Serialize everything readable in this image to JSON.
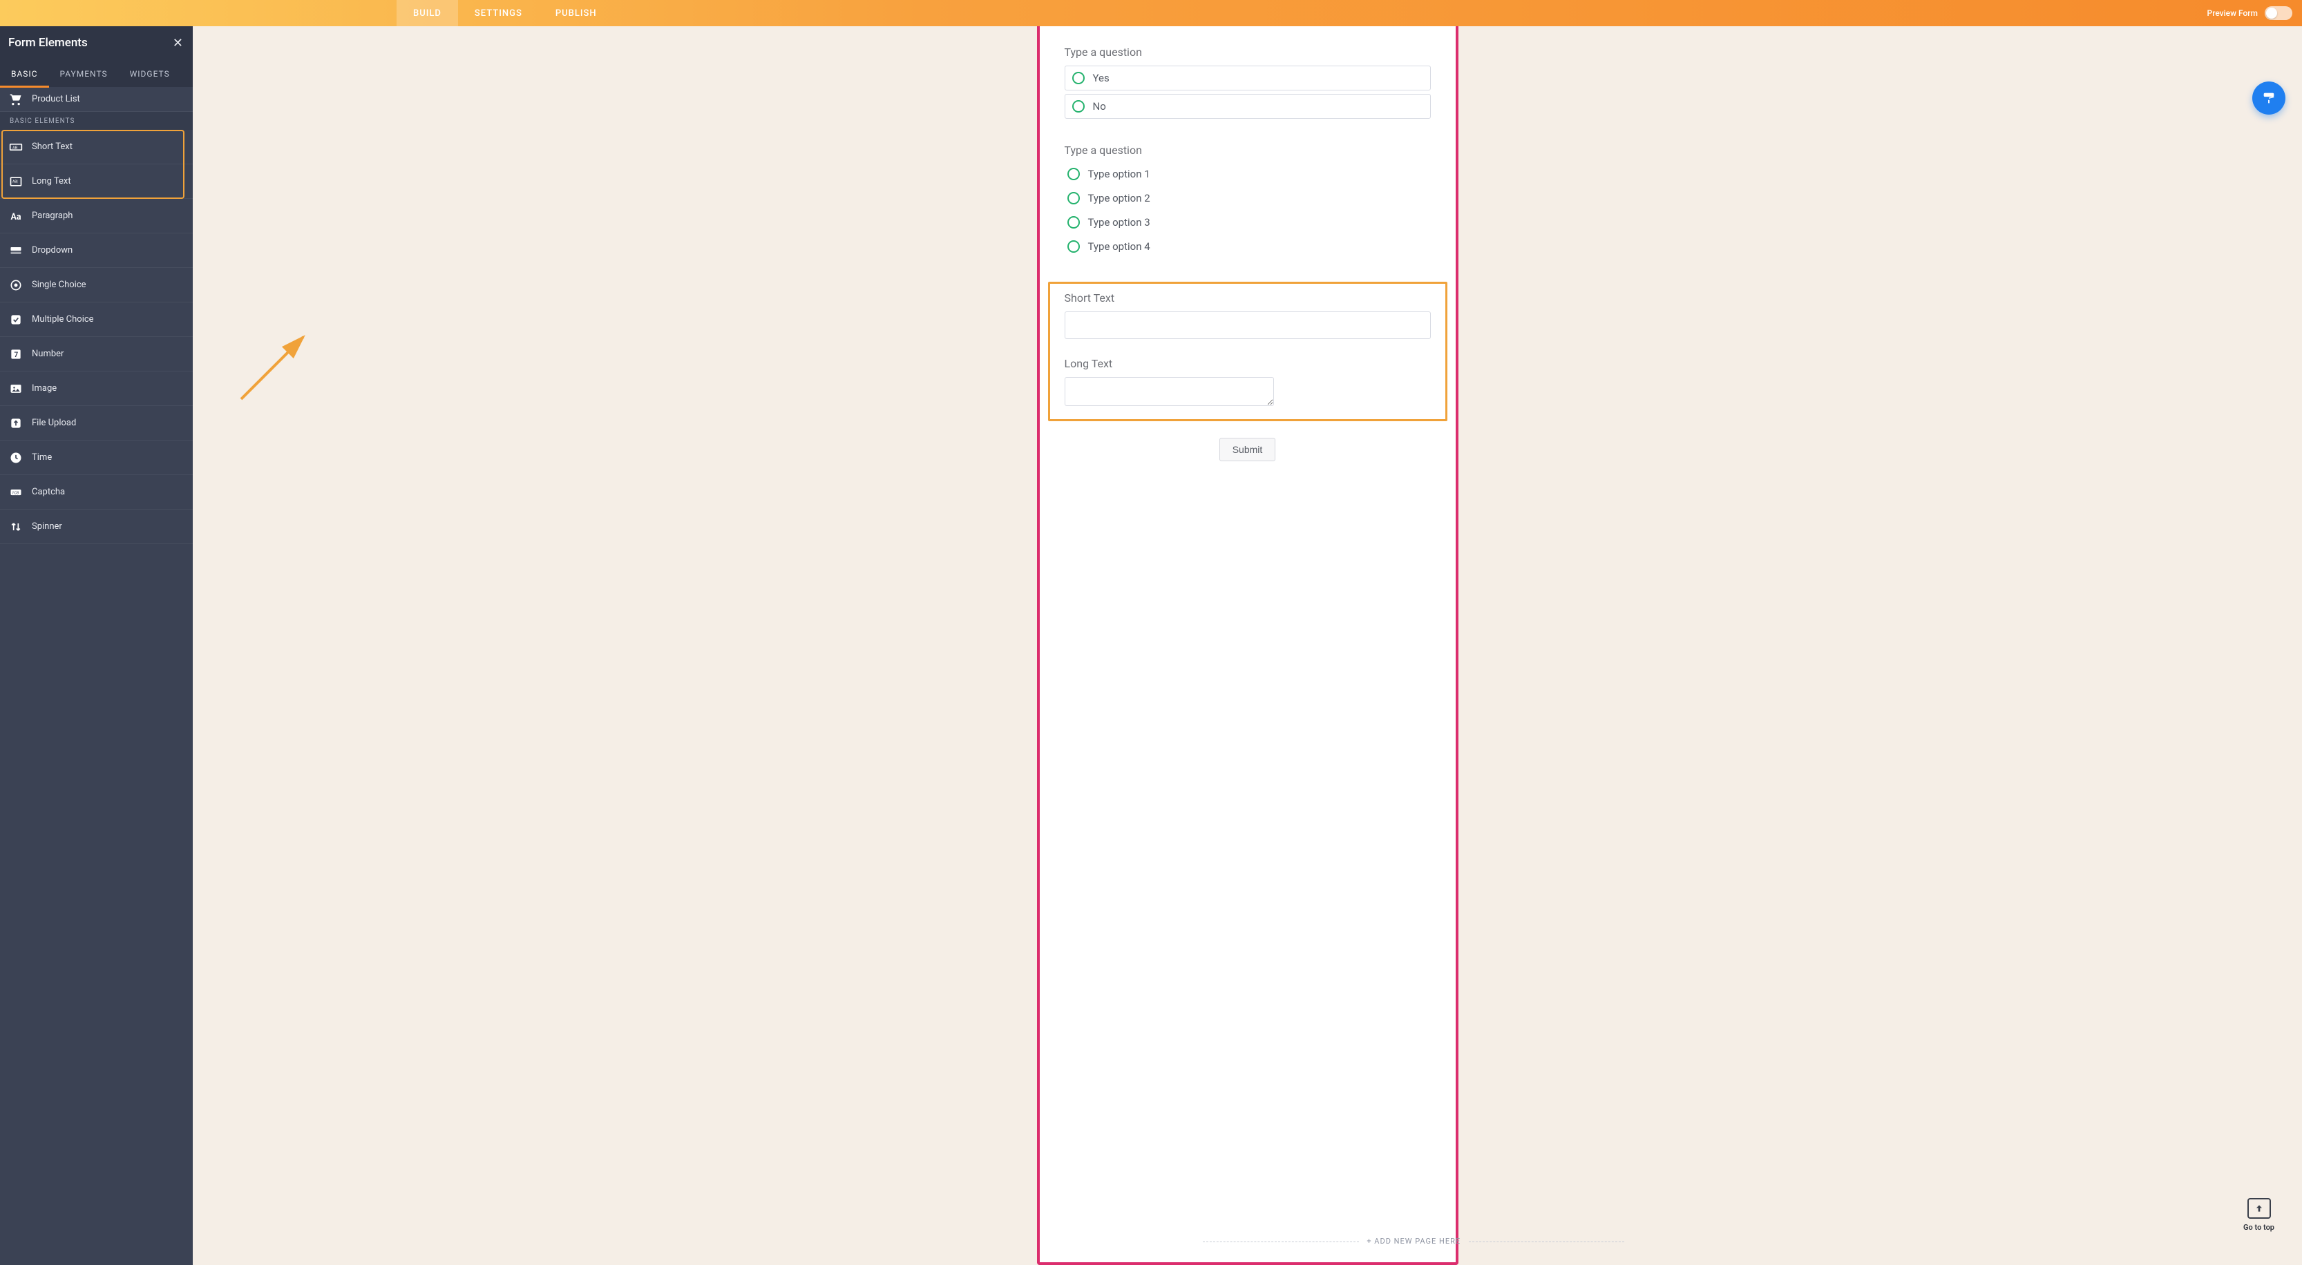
{
  "header": {
    "tabs": [
      "BUILD",
      "SETTINGS",
      "PUBLISH"
    ],
    "active_tab": 0,
    "preview_label": "Preview Form"
  },
  "sidebar": {
    "title": "Form Elements",
    "tabs": [
      "BASIC",
      "PAYMENTS",
      "WIDGETS"
    ],
    "active_tab": 0,
    "product_list_label": "Product List",
    "section_heading": "BASIC ELEMENTS",
    "items": [
      {
        "label": "Short Text",
        "icon": "short-text-icon"
      },
      {
        "label": "Long Text",
        "icon": "long-text-icon"
      },
      {
        "label": "Paragraph",
        "icon": "paragraph-icon"
      },
      {
        "label": "Dropdown",
        "icon": "dropdown-icon"
      },
      {
        "label": "Single Choice",
        "icon": "single-choice-icon"
      },
      {
        "label": "Multiple Choice",
        "icon": "multiple-choice-icon"
      },
      {
        "label": "Number",
        "icon": "number-icon"
      },
      {
        "label": "Image",
        "icon": "image-icon"
      },
      {
        "label": "File Upload",
        "icon": "file-upload-icon"
      },
      {
        "label": "Time",
        "icon": "time-icon"
      },
      {
        "label": "Captcha",
        "icon": "captcha-icon"
      },
      {
        "label": "Spinner",
        "icon": "spinner-icon"
      }
    ],
    "highlighted_range": [
      0,
      1
    ]
  },
  "form": {
    "q1": {
      "label": "Type a question",
      "options": [
        "Yes",
        "No"
      ]
    },
    "q2": {
      "label": "Type a question",
      "options": [
        "Type option 1",
        "Type option 2",
        "Type option 3",
        "Type option 4"
      ]
    },
    "short_text_label": "Short Text",
    "long_text_label": "Long Text",
    "submit_label": "Submit",
    "add_page_label": "+ ADD NEW PAGE HERE"
  },
  "floating": {
    "goto_top_label": "Go to top"
  },
  "colors": {
    "brand_orange": "#f68b2c",
    "highlight_orange": "#f0a23a",
    "form_border_pink": "#db2d6d",
    "radio_green": "#24b26d",
    "fab_blue": "#1f7ff0"
  }
}
